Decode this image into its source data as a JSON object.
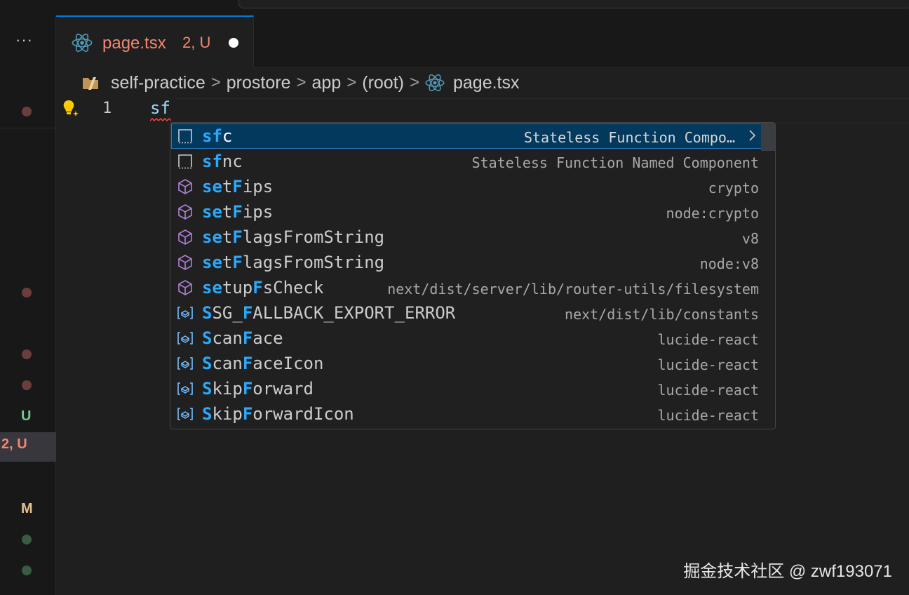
{
  "sidebar": {
    "more_label": "···",
    "u_badge": "U",
    "active_badge": "2, U",
    "m_badge": "M"
  },
  "tab": {
    "icon": "react-icon",
    "name": "page.tsx",
    "status": "2, U"
  },
  "breadcrumb": {
    "items": [
      "self-practice",
      "prostore",
      "app",
      "(root)",
      "page.tsx"
    ],
    "separator": ">"
  },
  "editor": {
    "line_number": "1",
    "code": "sf"
  },
  "suggestions": [
    {
      "icon": "snippet-icon",
      "match": "sf",
      "rest": "c",
      "detail": "Stateless Function Compo…",
      "selected": true
    },
    {
      "icon": "snippet-icon",
      "match": "sf",
      "rest": "nc",
      "detail": "Stateless Function Named Component"
    },
    {
      "icon": "module-icon",
      "parts": [
        [
          "se",
          1
        ],
        [
          "t",
          0
        ],
        [
          "F",
          1
        ],
        [
          "ips",
          0
        ]
      ],
      "detail": "crypto"
    },
    {
      "icon": "module-icon",
      "parts": [
        [
          "se",
          1
        ],
        [
          "t",
          0
        ],
        [
          "F",
          1
        ],
        [
          "ips",
          0
        ]
      ],
      "detail": "node:crypto"
    },
    {
      "icon": "module-icon",
      "parts": [
        [
          "se",
          1
        ],
        [
          "t",
          0
        ],
        [
          "F",
          1
        ],
        [
          "lagsFromString",
          0
        ]
      ],
      "detail": "v8"
    },
    {
      "icon": "module-icon",
      "parts": [
        [
          "se",
          1
        ],
        [
          "t",
          0
        ],
        [
          "F",
          1
        ],
        [
          "lagsFromString",
          0
        ]
      ],
      "detail": "node:v8"
    },
    {
      "icon": "module-icon",
      "parts": [
        [
          "se",
          1
        ],
        [
          "tup",
          0
        ],
        [
          "F",
          1
        ],
        [
          "sCheck",
          0
        ]
      ],
      "detail": "next/dist/server/lib/router-utils/filesystem"
    },
    {
      "icon": "variable-icon",
      "parts": [
        [
          "S",
          1
        ],
        [
          "SG_",
          0
        ],
        [
          "F",
          1
        ],
        [
          "ALLBACK_EXPORT_ERROR",
          0
        ]
      ],
      "detail": "next/dist/lib/constants"
    },
    {
      "icon": "variable-icon",
      "parts": [
        [
          "S",
          1
        ],
        [
          "can",
          0
        ],
        [
          "F",
          1
        ],
        [
          "ace",
          0
        ]
      ],
      "detail": "lucide-react"
    },
    {
      "icon": "variable-icon",
      "parts": [
        [
          "S",
          1
        ],
        [
          "can",
          0
        ],
        [
          "F",
          1
        ],
        [
          "aceIcon",
          0
        ]
      ],
      "detail": "lucide-react"
    },
    {
      "icon": "variable-icon",
      "parts": [
        [
          "S",
          1
        ],
        [
          "kip",
          0
        ],
        [
          "F",
          1
        ],
        [
          "orward",
          0
        ]
      ],
      "detail": "lucide-react"
    },
    {
      "icon": "variable-icon",
      "parts": [
        [
          "S",
          1
        ],
        [
          "kip",
          0
        ],
        [
          "F",
          1
        ],
        [
          "orwardIcon",
          0
        ]
      ],
      "detail": "lucide-react"
    }
  ],
  "watermark": "掘金技术社区 @ zwf193071",
  "colors": {
    "accent": "#0078d4",
    "highlight": "#2aaaff",
    "untracked": "#73c991",
    "error_tab": "#f48771",
    "modified": "#e2c08d",
    "module_icon": "#b180d7",
    "variable_icon": "#75beff"
  }
}
